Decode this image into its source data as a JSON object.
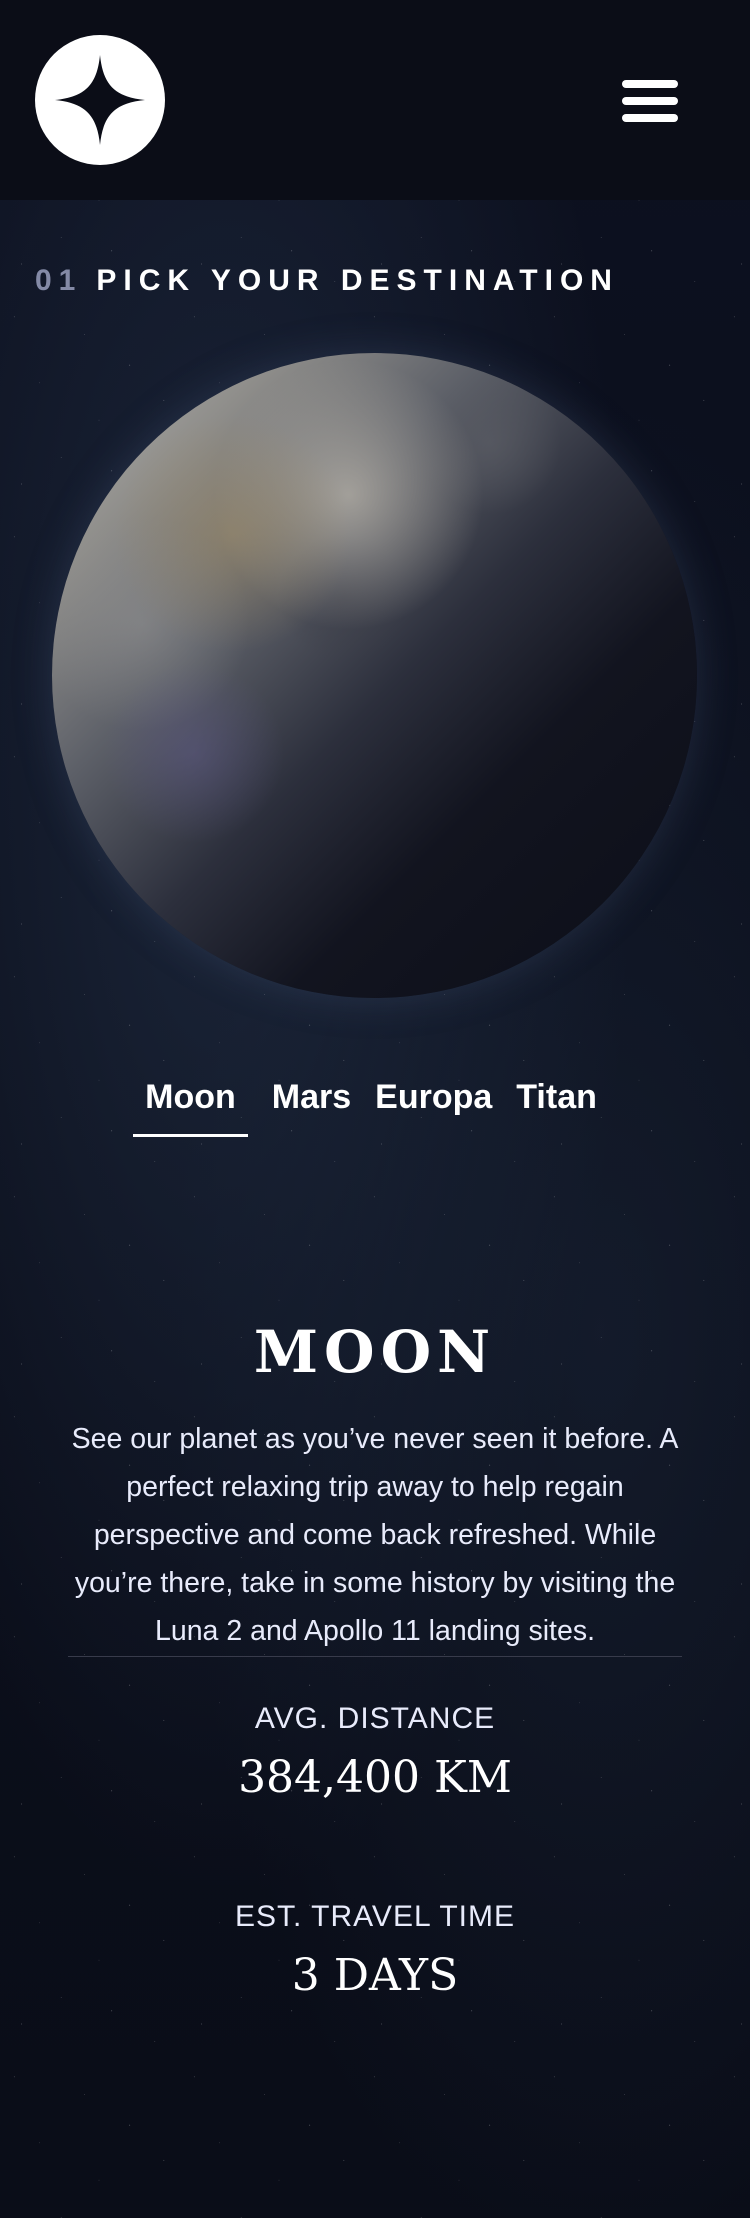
{
  "header": {
    "logo_icon": "star-logo-icon",
    "menu_icon": "hamburger-menu-icon"
  },
  "page_heading": {
    "number": "01",
    "title": "Pick your destination"
  },
  "destination_image_icon": "moon-image",
  "tabs": [
    {
      "label": "Moon",
      "active": true
    },
    {
      "label": "Mars",
      "active": false
    },
    {
      "label": "Europa",
      "active": false
    },
    {
      "label": "Titan",
      "active": false
    }
  ],
  "destination": {
    "name": "MOON",
    "description": "See our planet as you’ve never seen it before. A perfect relaxing trip away to help regain perspective and come back refreshed. While you’re there, take in some history by visiting the Luna 2 and Apollo 11 landing sites."
  },
  "stats": {
    "distance": {
      "label": "AVG. DISTANCE",
      "value": "384,400 km"
    },
    "travel": {
      "label": "EST. TRAVEL TIME",
      "value": "3 days"
    }
  },
  "colors": {
    "background": "#0b0d17",
    "text": "#ffffff",
    "accent": "#d0d6f9",
    "divider": "#383b4b"
  }
}
